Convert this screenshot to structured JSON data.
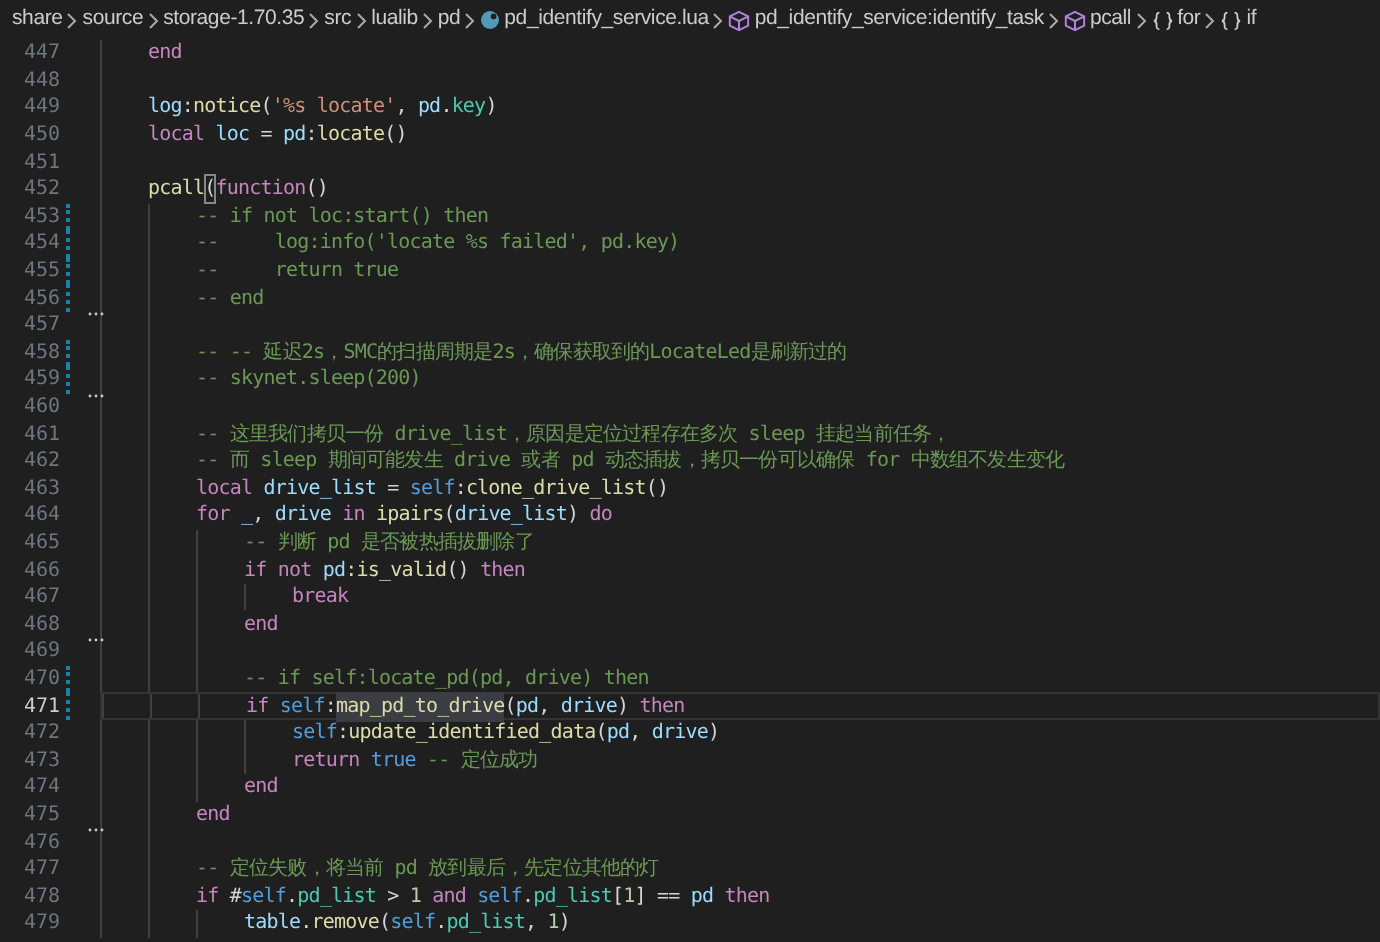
{
  "breadcrumb": [
    {
      "kind": "folder",
      "label": "share"
    },
    {
      "kind": "folder",
      "label": "source"
    },
    {
      "kind": "folder",
      "label": "storage-1.70.35"
    },
    {
      "kind": "folder",
      "label": "src"
    },
    {
      "kind": "folder",
      "label": "lualib"
    },
    {
      "kind": "folder",
      "label": "pd"
    },
    {
      "kind": "file",
      "label": "pd_identify_service.lua"
    },
    {
      "kind": "method",
      "label": "pd_identify_service:identify_task"
    },
    {
      "kind": "method",
      "label": "pcall"
    },
    {
      "kind": "block",
      "label": "for"
    },
    {
      "kind": "block",
      "label": "if"
    }
  ],
  "lines": [
    {
      "number": "447",
      "modified": false,
      "folded": false,
      "current": false,
      "tokens": [
        {
          "kind": "kw",
          "text": "end"
        }
      ]
    },
    {
      "number": "448",
      "modified": false,
      "folded": false,
      "current": false
    },
    {
      "number": "449",
      "modified": false,
      "folded": false,
      "current": false,
      "tokens": [
        {
          "kind": "var",
          "text": "log"
        },
        {
          "kind": "p",
          "text": ":"
        },
        {
          "kind": "fn",
          "text": "notice"
        },
        {
          "kind": "p",
          "text": "("
        },
        {
          "kind": "str",
          "text": "'%s locate'"
        },
        {
          "kind": "p",
          "text": ", "
        },
        {
          "kind": "var",
          "text": "pd"
        },
        {
          "kind": "p",
          "text": "."
        },
        {
          "kind": "prop",
          "text": "key"
        },
        {
          "kind": "p",
          "text": ")"
        }
      ]
    },
    {
      "number": "450",
      "modified": false,
      "folded": false,
      "current": false,
      "tokens": [
        {
          "kind": "kw",
          "text": "local "
        },
        {
          "kind": "var",
          "text": "loc"
        },
        {
          "kind": "p",
          "text": " = "
        },
        {
          "kind": "var",
          "text": "pd"
        },
        {
          "kind": "p",
          "text": ":"
        },
        {
          "kind": "fn",
          "text": "locate"
        },
        {
          "kind": "p",
          "text": "()"
        }
      ]
    },
    {
      "number": "451",
      "modified": false,
      "folded": false,
      "current": false
    },
    {
      "number": "452",
      "modified": false,
      "folded": false,
      "current": false,
      "tokens": [
        {
          "kind": "fn",
          "text": "pcall"
        },
        {
          "kind": "bracket",
          "text": "("
        },
        {
          "kind": "kw",
          "text": "function"
        },
        {
          "kind": "p",
          "text": "()"
        }
      ],
      "children": [
        {
          "number": "453",
          "modified": true,
          "folded": false,
          "current": false,
          "tokens": [
            {
              "kind": "comment",
              "text": "-- if not loc:start() then"
            }
          ]
        },
        {
          "number": "454",
          "modified": true,
          "folded": false,
          "current": false,
          "tokens": [
            {
              "kind": "comment",
              "text": "--     log:info('locate %s failed', pd.key)"
            }
          ]
        },
        {
          "number": "455",
          "modified": true,
          "folded": false,
          "current": false,
          "tokens": [
            {
              "kind": "comment",
              "text": "--     return true"
            }
          ]
        },
        {
          "number": "456",
          "modified": true,
          "folded": false,
          "current": false,
          "tokens": [
            {
              "kind": "comment",
              "text": "-- end"
            }
          ]
        },
        {
          "number": "457",
          "modified": false,
          "folded": true,
          "current": false
        },
        {
          "number": "458",
          "modified": true,
          "folded": false,
          "current": false,
          "tokens": [
            {
              "kind": "comment",
              "text": "-- -- 延迟2s，SMC的扫描周期是2s，确保获取到的LocateLed是刷新过的"
            }
          ]
        },
        {
          "number": "459",
          "modified": true,
          "folded": false,
          "current": false,
          "tokens": [
            {
              "kind": "comment",
              "text": "-- skynet.sleep(200)"
            }
          ]
        },
        {
          "number": "460",
          "modified": false,
          "folded": true,
          "current": false
        },
        {
          "number": "461",
          "modified": false,
          "folded": false,
          "current": false,
          "tokens": [
            {
              "kind": "comment",
              "text": "-- 这里我们拷贝一份 drive_list，原因是定位过程存在多次 sleep 挂起当前任务，"
            }
          ]
        },
        {
          "number": "462",
          "modified": false,
          "folded": false,
          "current": false,
          "tokens": [
            {
              "kind": "comment",
              "text": "-- 而 sleep 期间可能发生 drive 或者 pd 动态插拔，拷贝一份可以确保 for 中数组不发生变化"
            }
          ]
        },
        {
          "number": "463",
          "modified": false,
          "folded": false,
          "current": false,
          "tokens": [
            {
              "kind": "kw",
              "text": "local "
            },
            {
              "kind": "var",
              "text": "drive_list"
            },
            {
              "kind": "p",
              "text": " = "
            },
            {
              "kind": "const",
              "text": "self"
            },
            {
              "kind": "p",
              "text": ":"
            },
            {
              "kind": "fn",
              "text": "clone_drive_list"
            },
            {
              "kind": "p",
              "text": "()"
            }
          ]
        },
        {
          "number": "464",
          "modified": false,
          "folded": false,
          "current": false,
          "tokens": [
            {
              "kind": "kw",
              "text": "for "
            },
            {
              "kind": "var",
              "text": "_"
            },
            {
              "kind": "p",
              "text": ", "
            },
            {
              "kind": "var",
              "text": "drive "
            },
            {
              "kind": "kw",
              "text": "in "
            },
            {
              "kind": "fn",
              "text": "ipairs"
            },
            {
              "kind": "p",
              "text": "("
            },
            {
              "kind": "var",
              "text": "drive_list"
            },
            {
              "kind": "p",
              "text": ") "
            },
            {
              "kind": "kw",
              "text": "do"
            }
          ],
          "children": [
            {
              "number": "465",
              "modified": false,
              "folded": false,
              "current": false,
              "tokens": [
                {
                  "kind": "comment",
                  "text": "-- 判断 pd 是否被热插拔删除了"
                }
              ]
            },
            {
              "number": "466",
              "modified": false,
              "folded": false,
              "current": false,
              "tokens": [
                {
                  "kind": "kw",
                  "text": "if not "
                },
                {
                  "kind": "var",
                  "text": "pd"
                },
                {
                  "kind": "p",
                  "text": ":"
                },
                {
                  "kind": "fn",
                  "text": "is_valid"
                },
                {
                  "kind": "p",
                  "text": "() "
                },
                {
                  "kind": "kw",
                  "text": "then"
                }
              ],
              "children": [
                {
                  "number": "467",
                  "modified": false,
                  "folded": false,
                  "current": false,
                  "tokens": [
                    {
                      "kind": "kw",
                      "text": "break"
                    }
                  ]
                }
              ]
            },
            {
              "number": "468",
              "modified": false,
              "folded": false,
              "current": false,
              "tokens": [
                {
                  "kind": "kw",
                  "text": "end"
                }
              ]
            },
            {
              "number": "469",
              "modified": false,
              "folded": true,
              "current": false
            },
            {
              "number": "470",
              "modified": true,
              "folded": false,
              "current": false,
              "tokens": [
                {
                  "kind": "comment",
                  "text": "-- if self:locate_pd(pd, drive) then"
                }
              ]
            },
            {
              "number": "471",
              "modified": true,
              "folded": false,
              "current": true,
              "tokens": [
                {
                  "kind": "kw",
                  "text": "if "
                },
                {
                  "kind": "const",
                  "text": "self"
                },
                {
                  "kind": "p",
                  "text": ":"
                },
                {
                  "kind": "match",
                  "text": "map_pd_to_drive"
                },
                {
                  "kind": "p",
                  "text": "("
                },
                {
                  "kind": "var",
                  "text": "pd"
                },
                {
                  "kind": "p",
                  "text": ", "
                },
                {
                  "kind": "var",
                  "text": "drive"
                },
                {
                  "kind": "p",
                  "text": ") "
                },
                {
                  "kind": "kw",
                  "text": "then"
                }
              ],
              "children": [
                {
                  "number": "472",
                  "modified": false,
                  "folded": false,
                  "current": false,
                  "tokens": [
                    {
                      "kind": "const",
                      "text": "self"
                    },
                    {
                      "kind": "p",
                      "text": ":"
                    },
                    {
                      "kind": "fn",
                      "text": "update_identified_data"
                    },
                    {
                      "kind": "p",
                      "text": "("
                    },
                    {
                      "kind": "var",
                      "text": "pd"
                    },
                    {
                      "kind": "p",
                      "text": ", "
                    },
                    {
                      "kind": "var",
                      "text": "drive"
                    },
                    {
                      "kind": "p",
                      "text": ")"
                    }
                  ]
                },
                {
                  "number": "473",
                  "modified": false,
                  "folded": false,
                  "current": false,
                  "tokens": [
                    {
                      "kind": "kw",
                      "text": "return "
                    },
                    {
                      "kind": "const",
                      "text": "true "
                    },
                    {
                      "kind": "comment",
                      "text": "-- 定位成功"
                    }
                  ]
                }
              ]
            },
            {
              "number": "474",
              "modified": false,
              "folded": false,
              "current": false,
              "tokens": [
                {
                  "kind": "kw",
                  "text": "end"
                }
              ]
            }
          ]
        },
        {
          "number": "475",
          "modified": false,
          "folded": false,
          "current": false,
          "tokens": [
            {
              "kind": "kw",
              "text": "end"
            }
          ]
        },
        {
          "number": "476",
          "modified": false,
          "folded": true,
          "current": false
        },
        {
          "number": "477",
          "modified": false,
          "folded": false,
          "current": false,
          "tokens": [
            {
              "kind": "comment",
              "text": "-- 定位失败，将当前 pd 放到最后，先定位其他的灯"
            }
          ]
        },
        {
          "number": "478",
          "modified": false,
          "folded": false,
          "current": false,
          "tokens": [
            {
              "kind": "kw",
              "text": "if "
            },
            {
              "kind": "p",
              "text": "#"
            },
            {
              "kind": "const",
              "text": "self"
            },
            {
              "kind": "p",
              "text": "."
            },
            {
              "kind": "prop",
              "text": "pd_list"
            },
            {
              "kind": "p",
              "text": " > "
            },
            {
              "kind": "num",
              "text": "1 "
            },
            {
              "kind": "kw",
              "text": "and "
            },
            {
              "kind": "const",
              "text": "self"
            },
            {
              "kind": "p",
              "text": "."
            },
            {
              "kind": "prop",
              "text": "pd_list"
            },
            {
              "kind": "p",
              "text": "["
            },
            {
              "kind": "num",
              "text": "1"
            },
            {
              "kind": "p",
              "text": "] == "
            },
            {
              "kind": "var",
              "text": "pd "
            },
            {
              "kind": "kw",
              "text": "then"
            }
          ],
          "children": [
            {
              "number": "479",
              "modified": false,
              "folded": false,
              "current": false,
              "tokens": [
                {
                  "kind": "var",
                  "text": "table"
                },
                {
                  "kind": "p",
                  "text": "."
                },
                {
                  "kind": "fn",
                  "text": "remove"
                },
                {
                  "kind": "p",
                  "text": "("
                },
                {
                  "kind": "const",
                  "text": "self"
                },
                {
                  "kind": "p",
                  "text": "."
                },
                {
                  "kind": "prop",
                  "text": "pd_list"
                },
                {
                  "kind": "p",
                  "text": ", "
                },
                {
                  "kind": "num",
                  "text": "1"
                },
                {
                  "kind": "p",
                  "text": ")"
                }
              ]
            }
          ]
        }
      ]
    }
  ]
}
